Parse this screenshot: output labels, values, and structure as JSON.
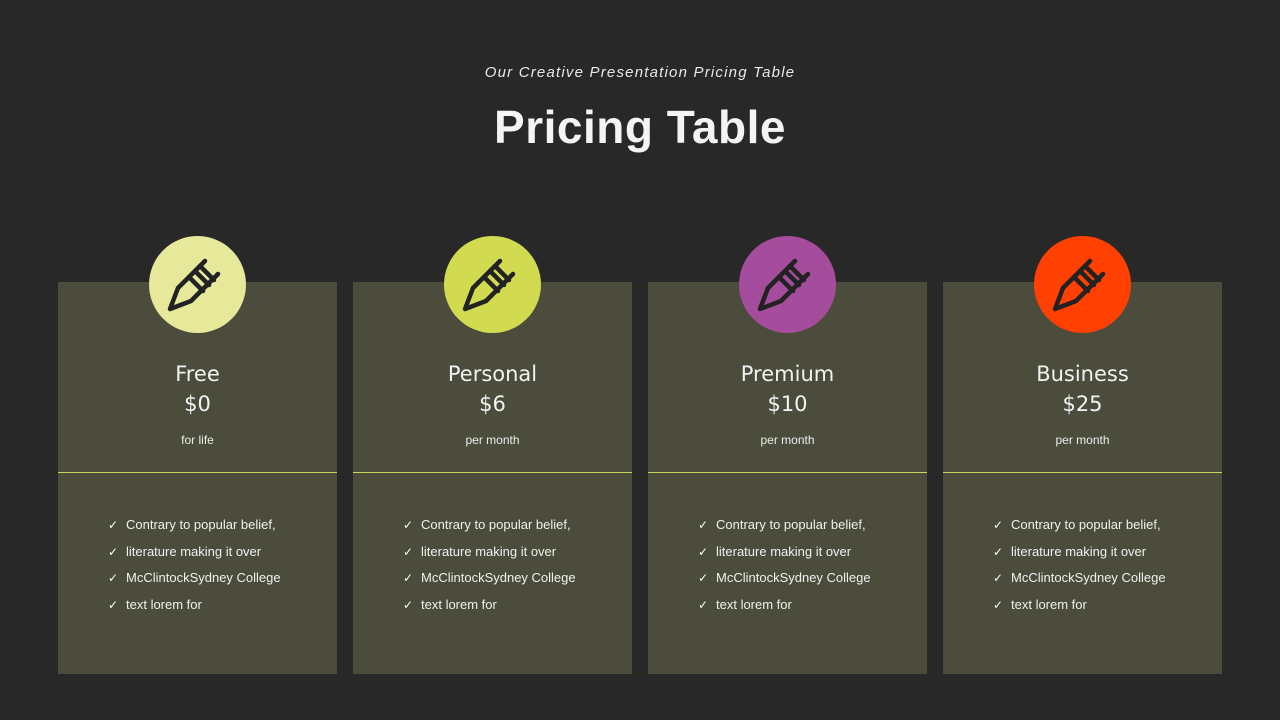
{
  "header": {
    "subtitle": "Our Creative Presentation Pricing Table",
    "title": "Pricing Table"
  },
  "icon_name": "pen-icon",
  "check_glyph": "✓",
  "plans": [
    {
      "name": "Free",
      "price": "$0",
      "period": "for life",
      "color": "#e6e89a",
      "features": [
        "Contrary to popular belief,",
        "literature making it over",
        "McClintockSydney College",
        "text lorem for"
      ]
    },
    {
      "name": "Personal",
      "price": "$6",
      "period": "per month",
      "color": "#d2da50",
      "features": [
        "Contrary to popular belief,",
        "literature making it over",
        "McClintockSydney College",
        "text lorem for"
      ]
    },
    {
      "name": "Premium",
      "price": "$10",
      "period": "per month",
      "color": "#a64c9c",
      "features": [
        "Contrary to popular belief,",
        "literature making it over",
        "McClintockSydney College",
        "text lorem for"
      ]
    },
    {
      "name": "Business",
      "price": "$25",
      "period": "per month",
      "color": "#ff4000",
      "features": [
        "Contrary to popular belief,",
        "literature making it over",
        "McClintockSydney College",
        "text lorem for"
      ]
    }
  ]
}
